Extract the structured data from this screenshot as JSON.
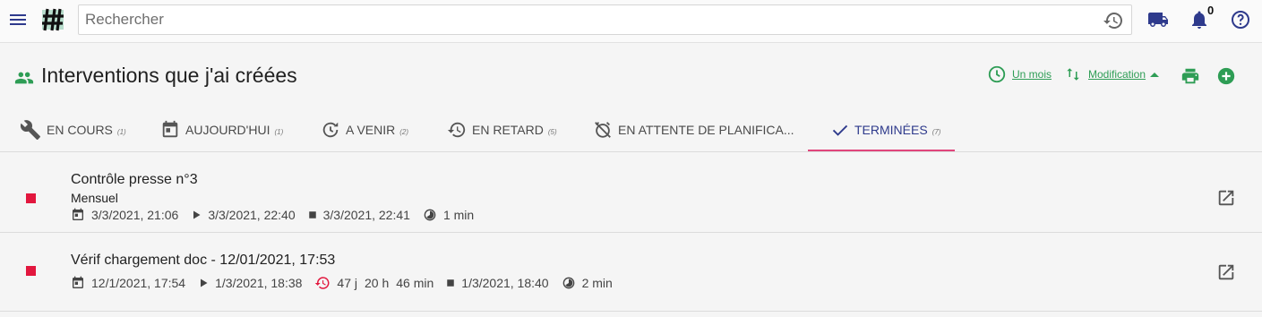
{
  "header": {
    "search_placeholder": "Rechercher",
    "notification_count": "0"
  },
  "page": {
    "title": "Interventions que j'ai créées",
    "period_label": "Un mois",
    "sort_label": "Modification"
  },
  "tabs": [
    {
      "label": "EN COURS",
      "count": "(1)"
    },
    {
      "label": "AUJOURD'HUI",
      "count": "(1)"
    },
    {
      "label": "A VENIR",
      "count": "(2)"
    },
    {
      "label": "EN RETARD",
      "count": "(5)"
    },
    {
      "label": "EN ATTENTE DE PLANIFICA..."
    },
    {
      "label": "TERMINÉES",
      "count": "(7)"
    }
  ],
  "items": [
    {
      "title": "Contrôle presse n°3",
      "subtitle": "Mensuel",
      "planned": "3/3/2021, 21:06",
      "started": "3/3/2021, 22:40",
      "ended": "3/3/2021, 22:41",
      "duration": "1 min"
    },
    {
      "title": "Vérif chargement doc - 12/01/2021, 17:53",
      "planned": "12/1/2021, 17:54",
      "started": "1/3/2021, 18:38",
      "late_days": "47 j",
      "late_hours": "20 h",
      "late_minutes": "46 min",
      "ended": "1/3/2021, 18:40",
      "duration": "2 min"
    }
  ],
  "colors": {
    "accent_green": "#2e9d55",
    "nav_blue": "#2e3a8c",
    "tab_underline": "#e0457b",
    "status_red": "#e2173e"
  }
}
